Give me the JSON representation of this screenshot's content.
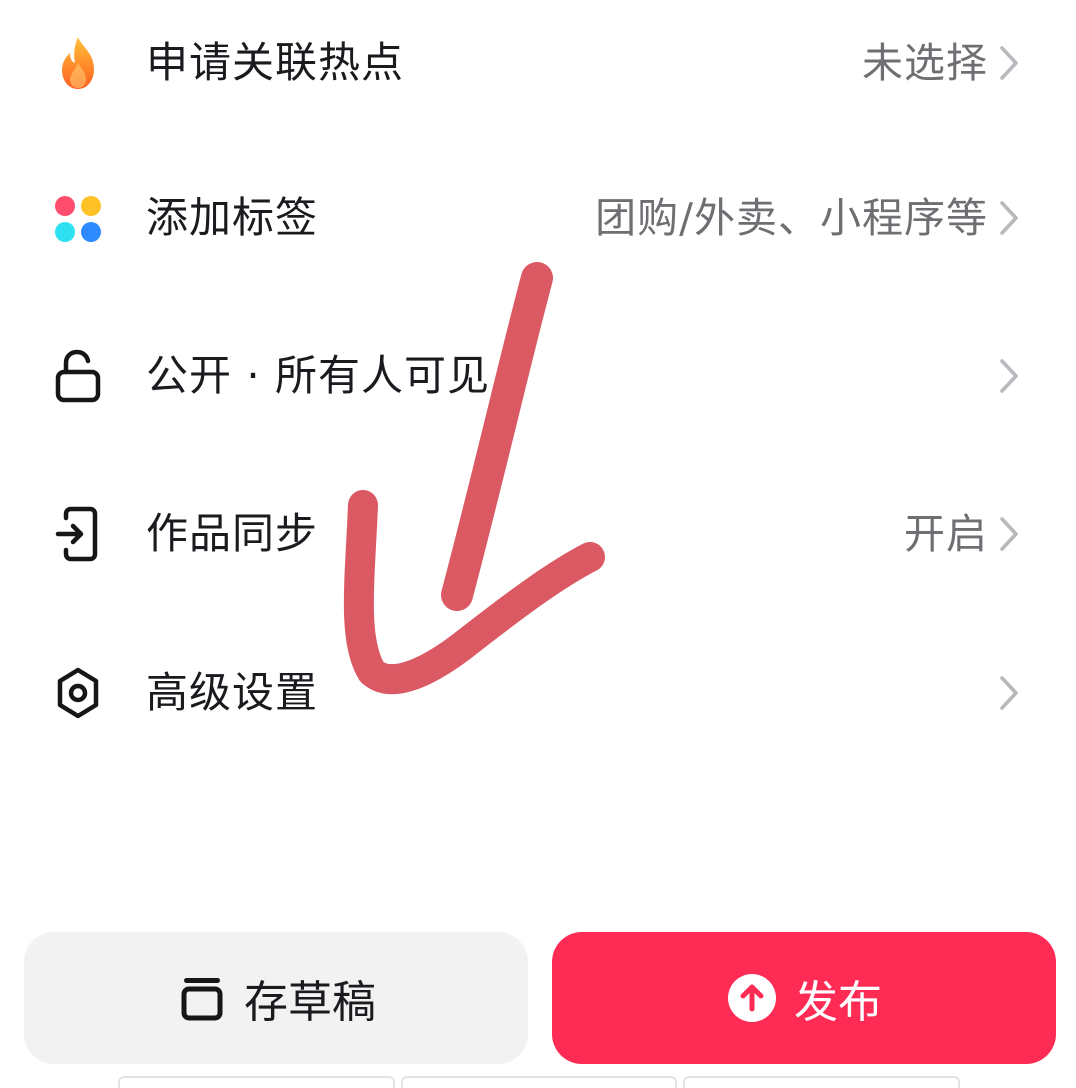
{
  "rows": [
    {
      "label": "申请关联热点",
      "value": "未选择",
      "icon": "flame-icon"
    },
    {
      "label": "添加标签",
      "value": "团购/外卖、小程序等",
      "icon": "four-dots-icon"
    },
    {
      "label": "公开 · 所有人可见",
      "value": "",
      "icon": "unlock-icon"
    },
    {
      "label": "作品同步",
      "value": "开启",
      "icon": "sync-exit-icon"
    },
    {
      "label": "高级设置",
      "value": "",
      "icon": "hexagon-settings-icon"
    }
  ],
  "actions": {
    "draft_label": "存草稿",
    "publish_label": "发布"
  },
  "colors": {
    "publish": "#fe2c55",
    "draft_bg": "#f2f2f3",
    "annotation": "#d9505a",
    "flame_top": "#ffb429",
    "flame_bottom": "#ff6a1a"
  }
}
